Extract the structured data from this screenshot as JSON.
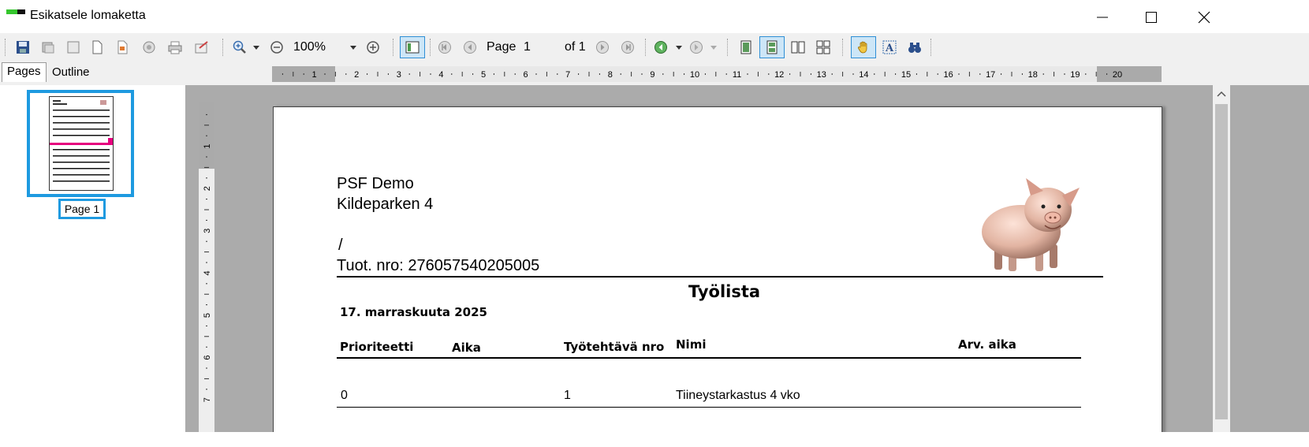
{
  "window": {
    "title": "Esikatsele lomaketta"
  },
  "toolbar": {
    "zoom": "100%",
    "page_label": "Page",
    "page_number": "1",
    "of_label": "of 1"
  },
  "sidebar": {
    "tabs": [
      "Pages",
      "Outline"
    ],
    "thumbnail_label": "Page 1"
  },
  "ruler": {
    "h_labels": [
      "1",
      "2",
      "3",
      "4",
      "5",
      "6",
      "7",
      "8",
      "9",
      "10",
      "11",
      "12",
      "13",
      "14",
      "15",
      "16",
      "17",
      "18",
      "19",
      "20"
    ],
    "v_labels": [
      "1",
      "2",
      "3",
      "4",
      "5",
      "6",
      "7"
    ]
  },
  "document": {
    "company": "PSF Demo",
    "address": "Kildeparken 4",
    "slash": "/",
    "product_number": "Tuot. nro: 276057540205005",
    "report_title": "Työlista",
    "date": "17. marraskuuta 2025",
    "columns": [
      "Prioriteetti",
      "Aika",
      "Työtehtävä nro",
      "Nimi",
      "Arv. aika"
    ],
    "rows": [
      {
        "priority": "0",
        "time": "",
        "task_no": "1",
        "name": "Tiineystarkastus 4 vko",
        "est": ""
      }
    ]
  }
}
